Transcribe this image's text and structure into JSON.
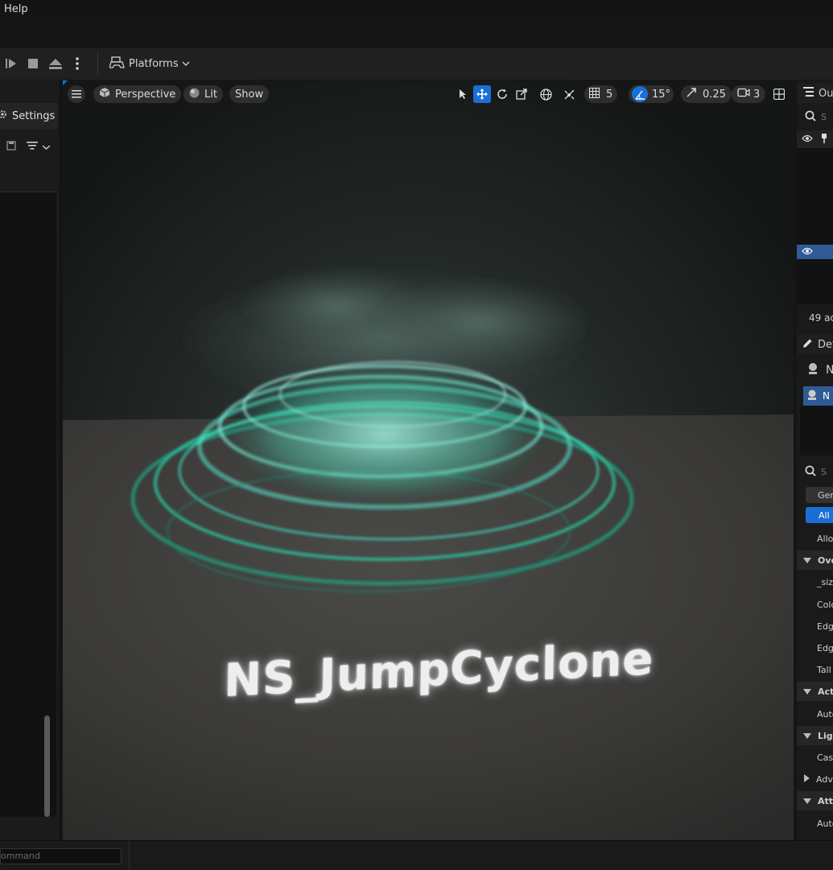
{
  "menubar": {
    "help": "Help"
  },
  "toolbar": {
    "platforms_label": "Platforms"
  },
  "left_panel": {
    "settings_tab": "Settings"
  },
  "viewport": {
    "perspective_label": "Perspective",
    "lit_label": "Lit",
    "show_label": "Show",
    "grid_snap_value": "5",
    "rotation_snap_value": "15°",
    "scale_snap_value": "0.25",
    "camera_speed_value": "3",
    "scene_text": "NS_JumpCyclone"
  },
  "right_panel": {
    "outliner_tab": "Ou",
    "search_placeholder": "S",
    "actor_count": "49 ac",
    "details_tab": "Det",
    "component_root": "N",
    "component_selected": "N",
    "details_search_placeholder": "S",
    "filter_general": "Gen",
    "filter_all": "All",
    "rows": [
      {
        "type": "item",
        "text": "Allov"
      },
      {
        "type": "section",
        "text": "Ove"
      },
      {
        "type": "item",
        "text": "_siz"
      },
      {
        "type": "item",
        "text": "Colo"
      },
      {
        "type": "item",
        "text": "Edge"
      },
      {
        "type": "item",
        "text": "Edge"
      },
      {
        "type": "item",
        "text": "Tall"
      },
      {
        "type": "section",
        "text": "Acti"
      },
      {
        "type": "item",
        "text": "Auto"
      },
      {
        "type": "section",
        "text": "Ligh"
      },
      {
        "type": "item",
        "text": "Cast"
      },
      {
        "type": "collapsed",
        "text": "Adva"
      },
      {
        "type": "section",
        "text": "Atta"
      },
      {
        "type": "item",
        "text": "Auto"
      }
    ]
  },
  "statusbar": {
    "command_placeholder": "ommand"
  },
  "colors": {
    "accent": "#1a6fd6",
    "cyclone": "#3fe0c0",
    "background": "#151515"
  }
}
